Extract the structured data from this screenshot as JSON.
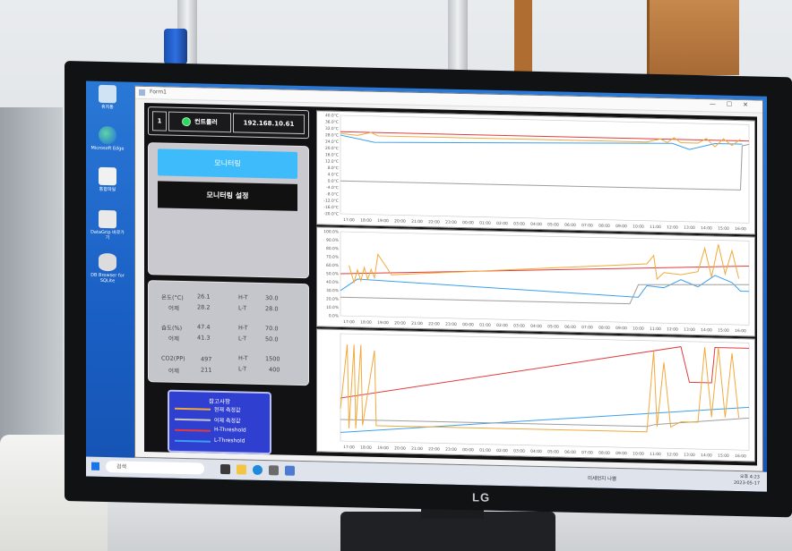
{
  "window": {
    "title": "Form1"
  },
  "connection": {
    "index": "1",
    "device": "컨트롤러",
    "ip": "192.168.10.61",
    "status_color": "#35d460"
  },
  "menu": {
    "monitoring": "모니터링",
    "monitoring_settings": "모니터링 설정"
  },
  "readings": {
    "temp_label": "온도(°C)",
    "temp_value": "26.1",
    "temp_yest_label": "어제",
    "temp_yest": "28.2",
    "temp_ht_label": "H-T",
    "temp_ht": "30.0",
    "temp_lt_label": "L-T",
    "temp_lt": "28.0",
    "hum_label": "습도(%)",
    "hum_value": "47.4",
    "hum_yest_label": "어제",
    "hum_yest": "41.3",
    "hum_ht_label": "H-T",
    "hum_ht": "70.0",
    "hum_lt_label": "L-T",
    "hum_lt": "50.0",
    "co2_label": "CO2(PP)",
    "co2_value": "497",
    "co2_yest_label": "어제",
    "co2_yest": "211",
    "co2_ht_label": "H-T",
    "co2_ht": "1500",
    "co2_lt_label": "L-T",
    "co2_lt": "400"
  },
  "legend": {
    "title": "참고사항",
    "items": [
      {
        "label": "현재 측정값",
        "color": "#f2a93b"
      },
      {
        "label": "어제 측정값",
        "color": "#c8c8c8"
      },
      {
        "label": "H-Threshold",
        "color": "#e33b3b"
      },
      {
        "label": "L-Threshold",
        "color": "#3aa0ee"
      }
    ]
  },
  "time_ticks": [
    "17:00",
    "18:00",
    "19:00",
    "20:00",
    "21:00",
    "22:00",
    "23:00",
    "00:00",
    "01:00",
    "02:00",
    "03:00",
    "04:00",
    "05:00",
    "06:00",
    "07:00",
    "08:00",
    "09:00",
    "10:00",
    "11:00",
    "12:00",
    "13:00",
    "14:00",
    "15:00",
    "16:00"
  ],
  "chart_data": [
    {
      "type": "line",
      "ylabels": [
        "40.0°C",
        "36.0°C",
        "32.0°C",
        "28.0°C",
        "24.0°C",
        "20.0°C",
        "16.0°C",
        "12.0°C",
        "8.0°C",
        "4.0°C",
        "0.0°C",
        "-4.0°C",
        "-8.0°C",
        "-12.0°C",
        "-16.0°C",
        "-20.0°C"
      ],
      "ylim": [
        -20,
        40
      ],
      "series": [
        {
          "color": "#e33b3b",
          "x": [
            0,
            24
          ],
          "y": [
            30,
            30
          ]
        },
        {
          "color": "#3aa0ee",
          "x": [
            0,
            2,
            19.5,
            20.5,
            22,
            23.6
          ],
          "y": [
            28,
            24,
            27.5,
            24,
            28,
            28
          ]
        },
        {
          "color": "#9e9e9e",
          "x": [
            0,
            23.5,
            23.6,
            24
          ],
          "y": [
            0,
            0,
            27,
            28
          ]
        },
        {
          "color": "#f2a93b",
          "x": [
            0,
            1,
            1.8,
            2.2,
            18,
            18.8,
            19.2,
            19.6,
            20,
            21,
            21.5,
            22,
            22.5,
            23,
            23.5
          ],
          "y": [
            29,
            28,
            30,
            28,
            28,
            30,
            28,
            31,
            28,
            28,
            31,
            26,
            31,
            27,
            31
          ]
        }
      ]
    },
    {
      "type": "line",
      "ylabels": [
        "100.0%",
        "90.0%",
        "80.0%",
        "70.0%",
        "60.0%",
        "50.0%",
        "40.0%",
        "30.0%",
        "20.0%",
        "10.0%",
        "0.0%"
      ],
      "ylim": [
        0,
        100
      ],
      "series": [
        {
          "color": "#e33b3b",
          "x": [
            0,
            24
          ],
          "y": [
            50,
            70
          ]
        },
        {
          "color": "#3aa0ee",
          "x": [
            0,
            1,
            17.5,
            18,
            19,
            20,
            21,
            22,
            23,
            23.5,
            24
          ],
          "y": [
            30,
            44,
            30,
            44,
            42,
            52,
            44,
            58,
            50,
            40,
            40
          ]
        },
        {
          "color": "#9e9e9e",
          "x": [
            0,
            17,
            17.5,
            24
          ],
          "y": [
            22,
            22,
            45,
            48
          ]
        },
        {
          "color": "#f2a93b",
          "x": [
            0.5,
            0.8,
            1,
            1.2,
            1.4,
            1.6,
            1.8,
            2.0,
            2.2,
            3,
            18,
            18.4,
            18.6,
            19,
            20,
            21,
            21.4,
            21.8,
            22.2,
            22.6,
            23,
            23.4
          ],
          "y": [
            60,
            40,
            55,
            42,
            58,
            44,
            56,
            46,
            74,
            50,
            70,
            80,
            52,
            60,
            58,
            62,
            90,
            56,
            95,
            60,
            88,
            55
          ]
        }
      ]
    },
    {
      "type": "line",
      "ylabels": [],
      "ylim": [
        0,
        100
      ],
      "series": [
        {
          "color": "#e33b3b",
          "x": [
            0,
            20,
            20.5,
            21.8,
            22,
            24
          ],
          "y": [
            40,
            95,
            62,
            62,
            95,
            95
          ]
        },
        {
          "color": "#3aa0ee",
          "x": [
            0,
            24
          ],
          "y": [
            8,
            40
          ]
        },
        {
          "color": "#9e9e9e",
          "x": [
            0,
            18,
            18.5,
            24
          ],
          "y": [
            20,
            20,
            22,
            30
          ]
        },
        {
          "color": "#f2a93b",
          "x": [
            0,
            0.4,
            0.5,
            0.8,
            0.9,
            1.2,
            1.3,
            2,
            2.1,
            2.8,
            18,
            18.4,
            18.6,
            19,
            19.4,
            20,
            21,
            21.4,
            21.8,
            22.2,
            22.6,
            23,
            23.4
          ],
          "y": [
            30,
            90,
            12,
            90,
            12,
            90,
            15,
            85,
            15,
            15,
            15,
            90,
            20,
            80,
            20,
            25,
            25,
            95,
            30,
            95,
            30,
            90,
            30
          ]
        }
      ]
    }
  ],
  "taskbar": {
    "search": "검색",
    "weather": "미세먼지 나쁨",
    "time": "오후 4:23",
    "date": "2023-05-17"
  },
  "desktop_icons": [
    {
      "label": "휴지통",
      "color": "#cfe3f5"
    },
    {
      "label": "Microsoft Edge",
      "color": "#2a9d8f"
    },
    {
      "label": "통합파일",
      "color": "#f1f1f1"
    },
    {
      "label": "DataGrip 바로가기",
      "color": "#e9e9e9"
    },
    {
      "label": "DB Browser for SQLite",
      "color": "#dcdcdc"
    }
  ]
}
